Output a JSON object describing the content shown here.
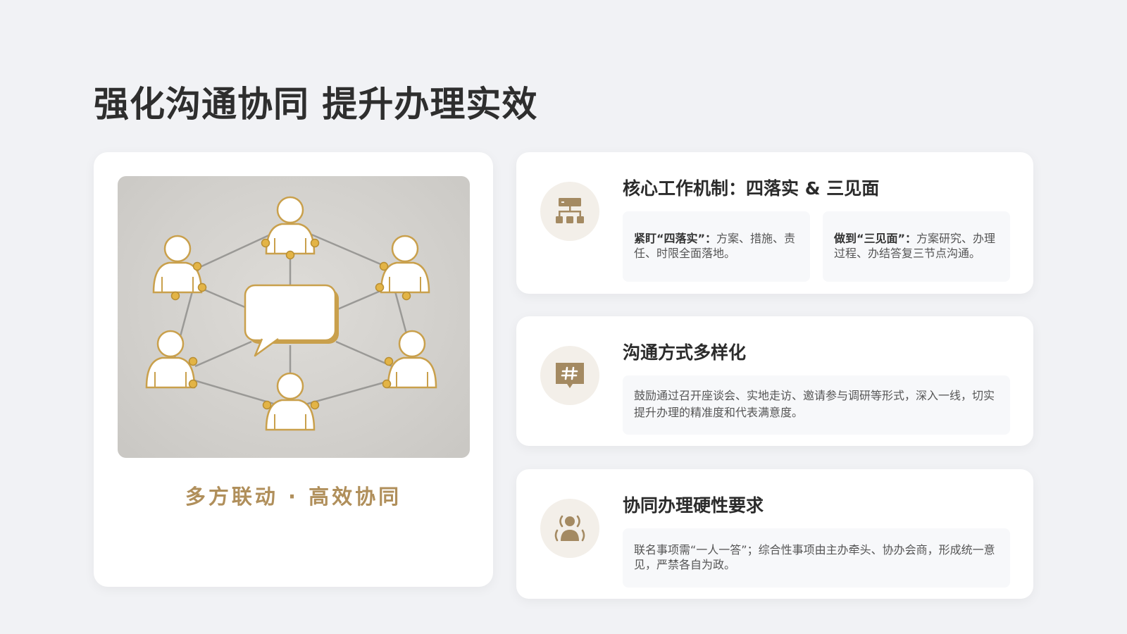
{
  "page": {
    "title": "强化沟通协同 提升办理实效"
  },
  "left_card": {
    "tagline": "多方联动 · 高效协同",
    "illustration_icon": "network-people-speech-bubble"
  },
  "cards": [
    {
      "icon": "hierarchy-icon",
      "title": "核心工作机制：四落实 & 三见面",
      "items": [
        {
          "label": "紧盯“四落实”：",
          "text": "方案、措施、责任、时限全面落地。"
        },
        {
          "label": "做到“三见面”：",
          "text": "方案研究、办理过程、办结答复三节点沟通。"
        }
      ]
    },
    {
      "icon": "chat-hash-icon",
      "title": "沟通方式多样化",
      "text": "鼓励通过召开座谈会、实地走访、邀请参与调研等形式，深入一线，切实提升办理的精准度和代表满意度。"
    },
    {
      "icon": "user-signal-icon",
      "title": "协同办理硬性要求",
      "text": "联名事项需“一人一答”；综合性事项由主办牵头、协办会商，形成统一意见，严禁各自为政。"
    }
  ],
  "colors": {
    "accent": "#b08f5b",
    "icon_fill": "#a48a62",
    "icon_bg": "#f3efe9",
    "page_bg": "#f1f2f5"
  }
}
